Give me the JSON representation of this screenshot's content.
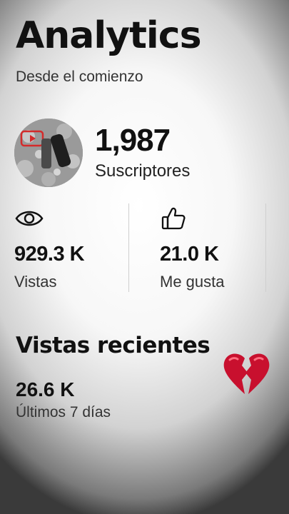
{
  "header": {
    "title": "Analytics",
    "subtitle": "Desde el comienzo"
  },
  "channel": {
    "subscribers_count": "1,987",
    "subscribers_label": "Suscriptores"
  },
  "stats": {
    "views": {
      "icon": "eye-icon",
      "value": "929.3 K",
      "label": "Vistas"
    },
    "likes": {
      "icon": "thumbs-up-icon",
      "value": "21.0 K",
      "label": "Me gusta"
    }
  },
  "recent": {
    "title": "Vistas recientes",
    "value": "26.6 K",
    "label": "Últimos 7 días",
    "emoji": "broken-heart-icon"
  },
  "colors": {
    "heart": "#c8102e",
    "avatar_badge": "#d42a2a"
  }
}
